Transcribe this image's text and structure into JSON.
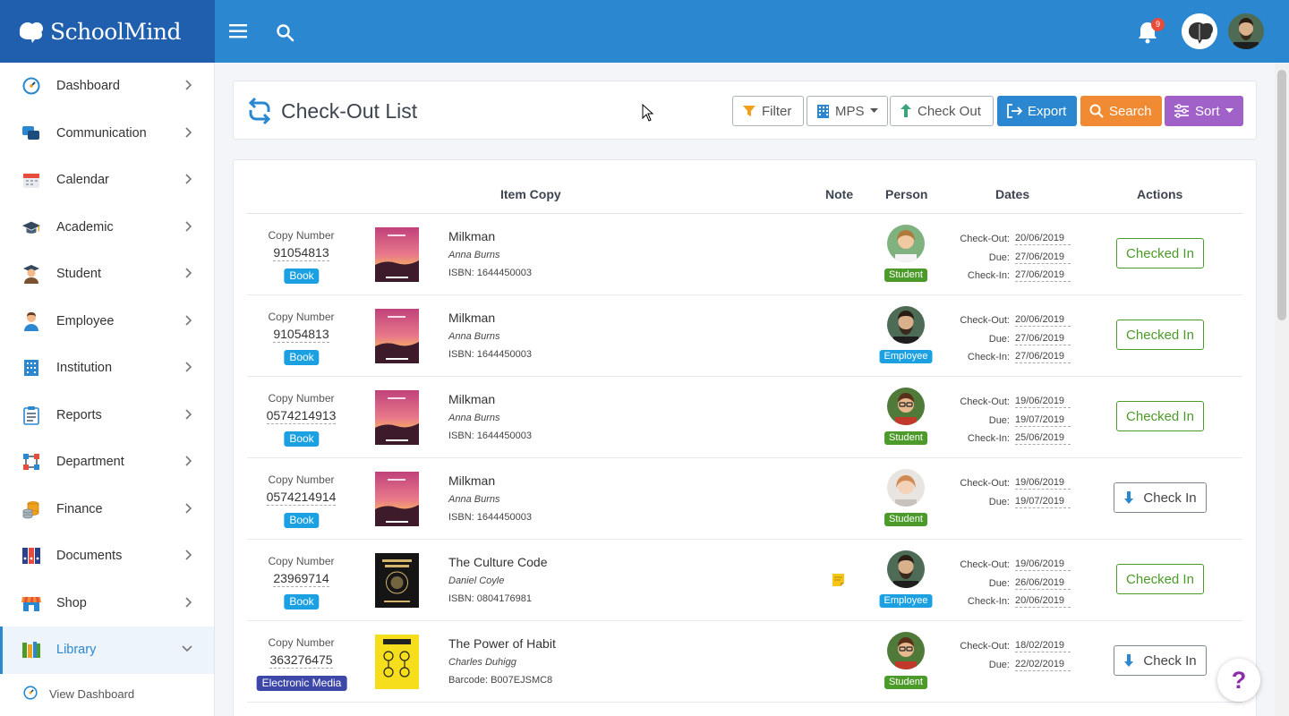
{
  "app": {
    "brand": "SchoolMind",
    "notification_count": "9"
  },
  "sidebar": {
    "items": [
      {
        "label": "Dashboard",
        "icon": "dashboard-icon"
      },
      {
        "label": "Communication",
        "icon": "chat-icon"
      },
      {
        "label": "Calendar",
        "icon": "calendar-icon"
      },
      {
        "label": "Academic",
        "icon": "graduation-cap-icon"
      },
      {
        "label": "Student",
        "icon": "student-icon"
      },
      {
        "label": "Employee",
        "icon": "employee-icon"
      },
      {
        "label": "Institution",
        "icon": "building-icon"
      },
      {
        "label": "Reports",
        "icon": "clipboard-icon"
      },
      {
        "label": "Department",
        "icon": "network-icon"
      },
      {
        "label": "Finance",
        "icon": "coins-icon"
      },
      {
        "label": "Documents",
        "icon": "binders-icon"
      },
      {
        "label": "Shop",
        "icon": "store-icon"
      },
      {
        "label": "Library",
        "icon": "books-icon",
        "active": true
      }
    ],
    "sub_item": "View Dashboard"
  },
  "page": {
    "title": "Check-Out List"
  },
  "toolbar": {
    "filter": "Filter",
    "mps": "MPS",
    "checkout": "Check Out",
    "export": "Export",
    "search": "Search",
    "sort": "Sort"
  },
  "table": {
    "headers": {
      "item_copy": "Item Copy",
      "note": "Note",
      "person": "Person",
      "dates": "Dates",
      "actions": "Actions"
    },
    "copy_label": "Copy Number",
    "date_labels": {
      "checkout": "Check-Out:",
      "due": "Due:",
      "checkin": "Check-In:"
    },
    "rows": [
      {
        "copy": "91054813",
        "type": "Book",
        "title": "Milkman",
        "author": "Anna Burns",
        "id": "ISBN: 1644450003",
        "note": false,
        "role": "Student",
        "checkout": "20/06/2019",
        "due": "27/06/2019",
        "checkin": "27/06/2019",
        "action": "Checked In"
      },
      {
        "copy": "91054813",
        "type": "Book",
        "title": "Milkman",
        "author": "Anna Burns",
        "id": "ISBN: 1644450003",
        "note": false,
        "role": "Employee",
        "checkout": "20/06/2019",
        "due": "27/06/2019",
        "checkin": "27/06/2019",
        "action": "Checked In"
      },
      {
        "copy": "0574214913",
        "type": "Book",
        "title": "Milkman",
        "author": "Anna Burns",
        "id": "ISBN: 1644450003",
        "note": false,
        "role": "Student",
        "checkout": "19/06/2019",
        "due": "19/07/2019",
        "checkin": "25/06/2019",
        "action": "Checked In"
      },
      {
        "copy": "0574214914",
        "type": "Book",
        "title": "Milkman",
        "author": "Anna Burns",
        "id": "ISBN: 1644450003",
        "note": false,
        "role": "Student",
        "checkout": "19/06/2019",
        "due": "19/07/2019",
        "checkin": "",
        "action": "Check In"
      },
      {
        "copy": "23969714",
        "type": "Book",
        "title": "The Culture Code",
        "author": "Daniel Coyle",
        "id": "ISBN: 0804176981",
        "note": true,
        "role": "Employee",
        "checkout": "19/06/2019",
        "due": "26/06/2019",
        "checkin": "20/06/2019",
        "action": "Checked In"
      },
      {
        "copy": "363276475",
        "type": "Electronic Media",
        "title": "The Power of Habit",
        "author": "Charles Duhigg",
        "id": "Barcode: B007EJSMC8",
        "note": false,
        "role": "Student",
        "checkout": "18/02/2019",
        "due": "22/02/2019",
        "checkin": "",
        "action": "Check In"
      }
    ]
  },
  "help": {
    "label": "?"
  }
}
